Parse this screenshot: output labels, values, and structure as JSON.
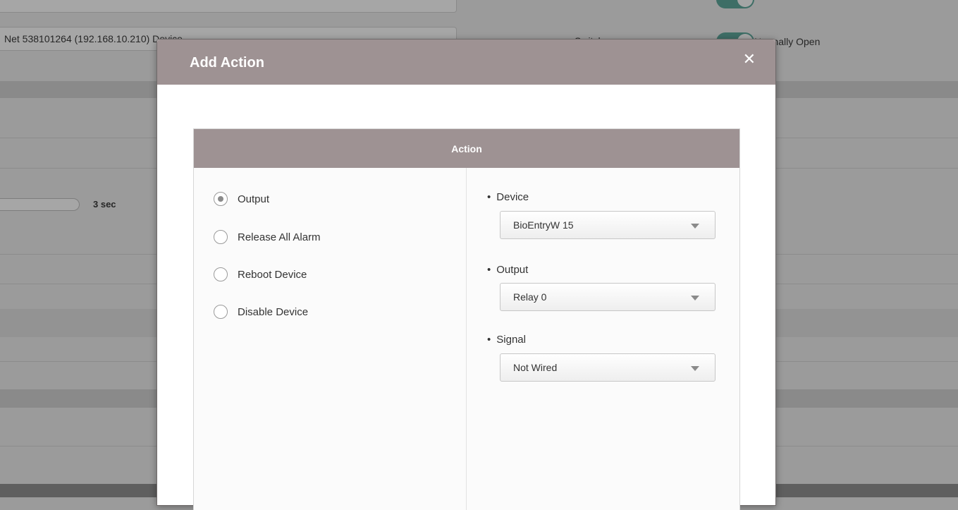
{
  "background": {
    "device_field": "Net 538101264 (192.168.10.210) Device",
    "switch_label": "Switch",
    "switch_value": "Normally Open",
    "slider_value": "3 sec"
  },
  "modal": {
    "title": "Add Action",
    "close_icon": "close-icon",
    "panel_title": "Action",
    "actions": [
      {
        "label": "Output",
        "checked": true
      },
      {
        "label": "Release All Alarm",
        "checked": false
      },
      {
        "label": "Reboot Device",
        "checked": false
      },
      {
        "label": "Disable Device",
        "checked": false
      }
    ],
    "fields": {
      "device": {
        "label": "Device",
        "value": "BioEntryW 15"
      },
      "output": {
        "label": "Output",
        "value": "Relay 0"
      },
      "signal": {
        "label": "Signal",
        "value": "Not Wired"
      }
    }
  },
  "colors": {
    "header": "#9e9293",
    "overlay": "#9b9b9b",
    "toggle_on": "#3e6e66"
  }
}
